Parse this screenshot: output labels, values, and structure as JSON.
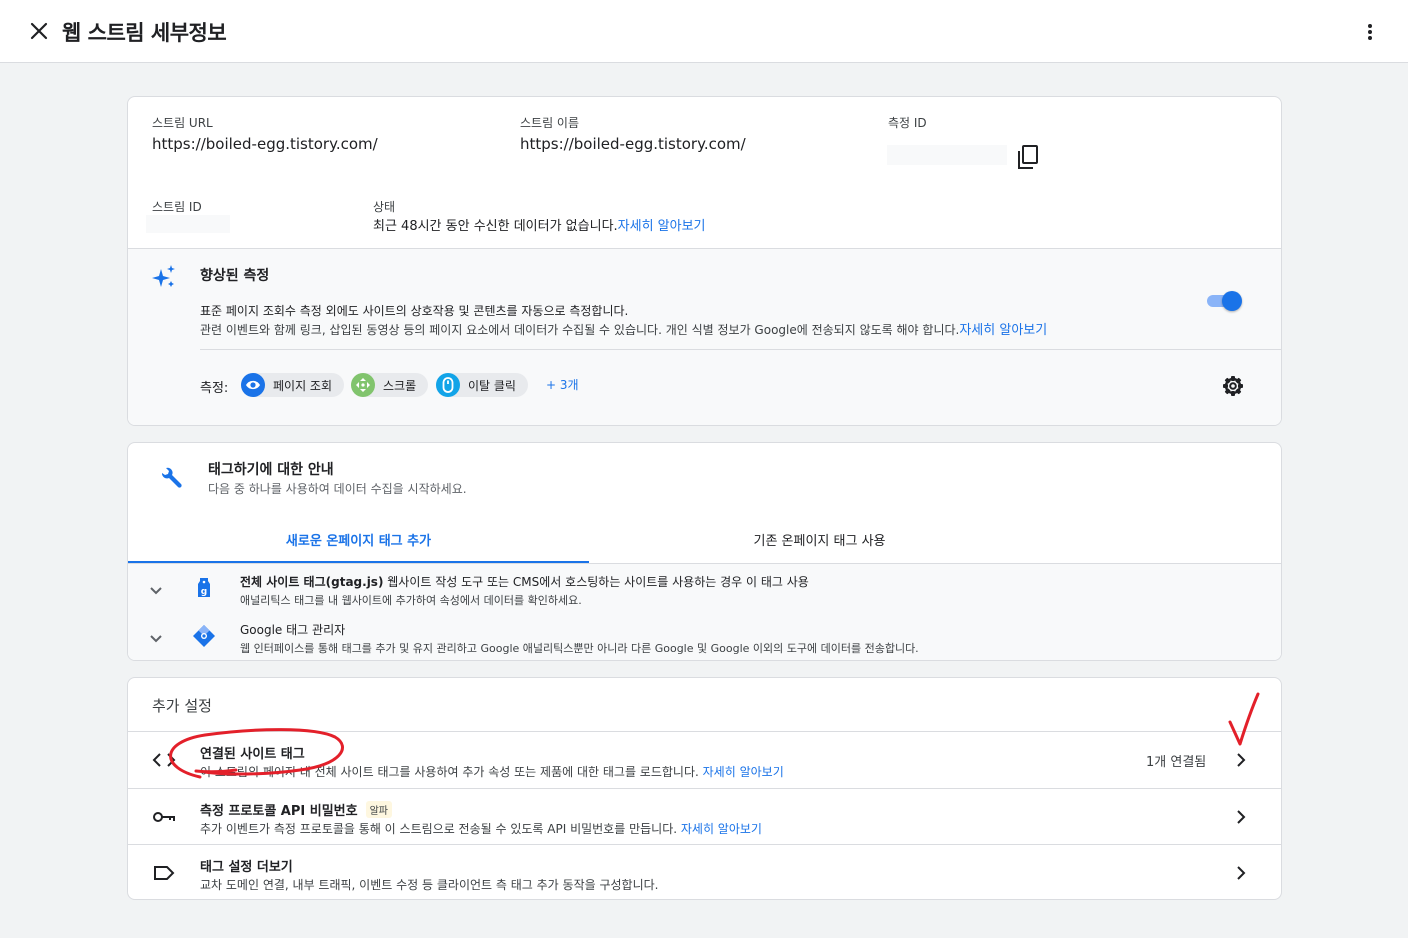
{
  "header": {
    "title": "웹 스트림 세부정보"
  },
  "stream": {
    "url_label": "스트림 URL",
    "url_value": "https://boiled-egg.tistory.com/",
    "name_label": "스트림 이름",
    "name_value": "https://boiled-egg.tistory.com/",
    "measurement_id_label": "측정 ID",
    "stream_id_label": "스트림 ID",
    "status_label": "상태",
    "status_text": "최근 48시간 동안 수신한 데이터가 없습니다.",
    "status_link": "자세히 알아보기"
  },
  "enhanced": {
    "title": "향상된 측정",
    "desc1": "표준 페이지 조회수 측정 외에도 사이트의 상호작용 및 콘텐츠를 자동으로 측정합니다.",
    "desc2": "관련 이벤트와 함께 링크, 삽입된 동영상 등의 페이지 요소에서 데이터가 수집될 수 있습니다. 개인 식별 정보가 Google에 전송되지 않도록 해야 합니다.",
    "desc2_link": "자세히 알아보기",
    "measure_label": "측정:",
    "chips": [
      "페이지 조회",
      "스크롤",
      "이탈 클릭"
    ],
    "more": "+ 3개",
    "enabled": true
  },
  "tagging": {
    "title": "태그하기에 대한 안내",
    "subtitle": "다음 중 하나를 사용하여 데이터 수집을 시작하세요.",
    "tabs": [
      "새로운 온페이지 태그 추가",
      "기존 온페이지 태그 사용"
    ],
    "options": [
      {
        "title": "전체 사이트 태그(gtag.js)",
        "title_rest": " 웹사이트 작성 도구 또는 CMS에서 호스팅하는 사이트를 사용하는 경우 이 태그 사용",
        "desc": "애널리틱스 태그를 내 웹사이트에 추가하여 속성에서 데이터를 확인하세요."
      },
      {
        "title": "Google 태그 관리자",
        "desc": "웹 인터페이스를 통해 태그를 추가 및 유지 관리하고 Google 애널리틱스뿐만 아니라 다른 Google 및 Google 이외의 도구에 데이터를 전송합니다."
      }
    ]
  },
  "additional": {
    "title": "추가 설정",
    "rows": [
      {
        "title": "연결된 사이트 태그",
        "desc": "이 스트림의 페이지 내 전체 사이트 태그를 사용하여 추가 속성 또는 제품에 대한 태그를 로드합니다. ",
        "link": "자세히 알아보기",
        "count": "1개 연결됨"
      },
      {
        "title": "측정 프로토콜 API 비밀번호",
        "badge": "알파",
        "desc": "추가 이벤트가 측정 프로토콜을 통해 이 스트림으로 전송될 수 있도록 API 비밀번호를 만듭니다. ",
        "link": "자세히 알아보기"
      },
      {
        "title": "태그 설정 더보기",
        "desc": "교차 도메인 연결, 내부 트래픽, 이벤트 수정 등 클라이언트 측 태그 추가 동작을 구성합니다."
      }
    ]
  },
  "colors": {
    "accent": "#1a73e8",
    "annotation": "#e3202a"
  }
}
